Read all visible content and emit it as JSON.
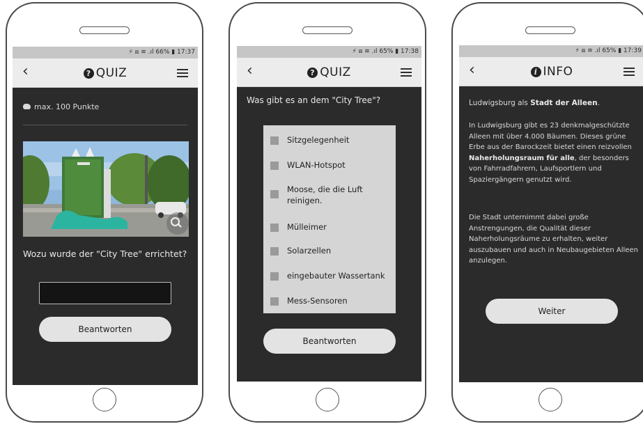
{
  "screen1": {
    "status": "⚡ ⧈ ≋ .ıl 66% ▮ 17:37",
    "title": "QUIZ",
    "points": "max. 100 Punkte",
    "question": "Wozu wurde der \"City Tree\" errichtet?",
    "answer_value": "",
    "submit": "Beantworten"
  },
  "screen2": {
    "status": "⚡ ⧈ ≋ .ıl 65% ▮ 17:38",
    "title": "QUIZ",
    "question": "Was gibt es an dem \"City Tree\"?",
    "options": [
      "Sitzgelegenheit",
      "WLAN-Hotspot",
      "Moose, die die Luft reinigen.",
      "Mülleimer",
      "Solarzellen",
      "eingebauter Wassertank",
      "Mess-Sensoren"
    ],
    "submit": "Beantworten"
  },
  "screen3": {
    "status": "⚡ ⧈ ≋ .ıl 65% ▮ 17:39",
    "title": "INFO",
    "p1": {
      "pre": "Ludwigsburg als ",
      "bold": "Stadt der Alleen",
      "post": "."
    },
    "p2": {
      "pre": "In Ludwigsburg gibt es 23 denkmalgeschützte Alleen mit über 4.000 Bäumen. Dieses grüne Erbe aus der Barockzeit bietet einen reizvollen ",
      "bold": "Naherholungsraum für alle",
      "post": ", der besonders von Fahrradfahrern, Laufsportlern und Spaziergängern genutzt wird."
    },
    "p3": "Die Stadt unternimmt dabei große Anstrengungen, die Qualität dieser Naherholungsräume zu erhalten, weiter auszubauen und auch in Neubaugebieten Alleen anzulegen.",
    "next": "Weiter"
  },
  "icons": {
    "back": "chevron-left-icon",
    "menu": "hamburger-menu-icon",
    "quiz": "question-circle-icon",
    "info": "info-circle-icon",
    "points": "piggy-bank-icon",
    "zoom": "magnifier-icon"
  },
  "colors": {
    "screen_bg": "#2b2b2b",
    "navbar_bg": "#ececec",
    "status_bg": "#c6c6c6",
    "button_bg": "#e3e3e3",
    "option_panel": "#d5d5d5"
  }
}
